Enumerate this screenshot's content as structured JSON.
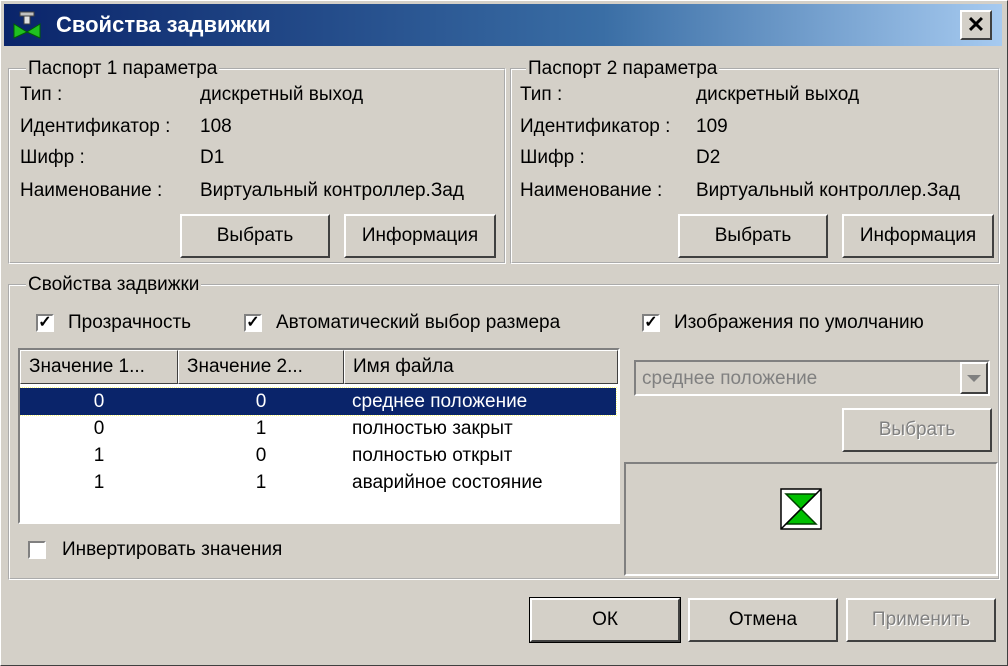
{
  "window": {
    "title": "Свойства задвижки",
    "close_label": "✕"
  },
  "passport1": {
    "legend": "Паспорт 1 параметра",
    "type_label": "Тип :",
    "type_value": "дискретный выход",
    "id_label": "Идентификатор :",
    "id_value": "108",
    "code_label": "Шифр :",
    "code_value": "D1",
    "name_label": "Наименование :",
    "name_value": "Виртуальный контроллер.Зад",
    "select_button": "Выбрать",
    "info_button": "Информация"
  },
  "passport2": {
    "legend": "Паспорт 2 параметра",
    "type_label": "Тип :",
    "type_value": "дискретный выход",
    "id_label": "Идентификатор :",
    "id_value": "109",
    "code_label": "Шифр :",
    "code_value": "D2",
    "name_label": "Наименование :",
    "name_value": "Виртуальный контроллер.Зад",
    "select_button": "Выбрать",
    "info_button": "Информация"
  },
  "properties": {
    "legend": "Свойства задвижки",
    "transparency": {
      "label": "Прозрачность",
      "checked": true
    },
    "auto_size": {
      "label": "Автоматический выбор размера",
      "checked": true
    },
    "default_images": {
      "label": "Изображения по умолчанию",
      "checked": true
    },
    "invert": {
      "label": "Инвертировать значения",
      "checked": false
    },
    "table": {
      "columns": [
        "Значение 1...",
        "Значение 2...",
        "Имя файла"
      ],
      "rows": [
        {
          "v1": "0",
          "v2": "0",
          "file": "среднее положение",
          "selected": true
        },
        {
          "v1": "0",
          "v2": "1",
          "file": "полностью закрыт",
          "selected": false
        },
        {
          "v1": "1",
          "v2": "0",
          "file": "полностью открыт",
          "selected": false
        },
        {
          "v1": "1",
          "v2": "1",
          "file": "аварийное состояние",
          "selected": false
        }
      ]
    },
    "image_select": {
      "value": "среднее положение"
    },
    "image_select_button": "Выбрать"
  },
  "footer": {
    "ok": "ОК",
    "cancel": "Отмена",
    "apply": "Применить"
  },
  "colors": {
    "selection": "#0a246a",
    "face": "#d4d0c8",
    "valve_green": "#00c000"
  }
}
